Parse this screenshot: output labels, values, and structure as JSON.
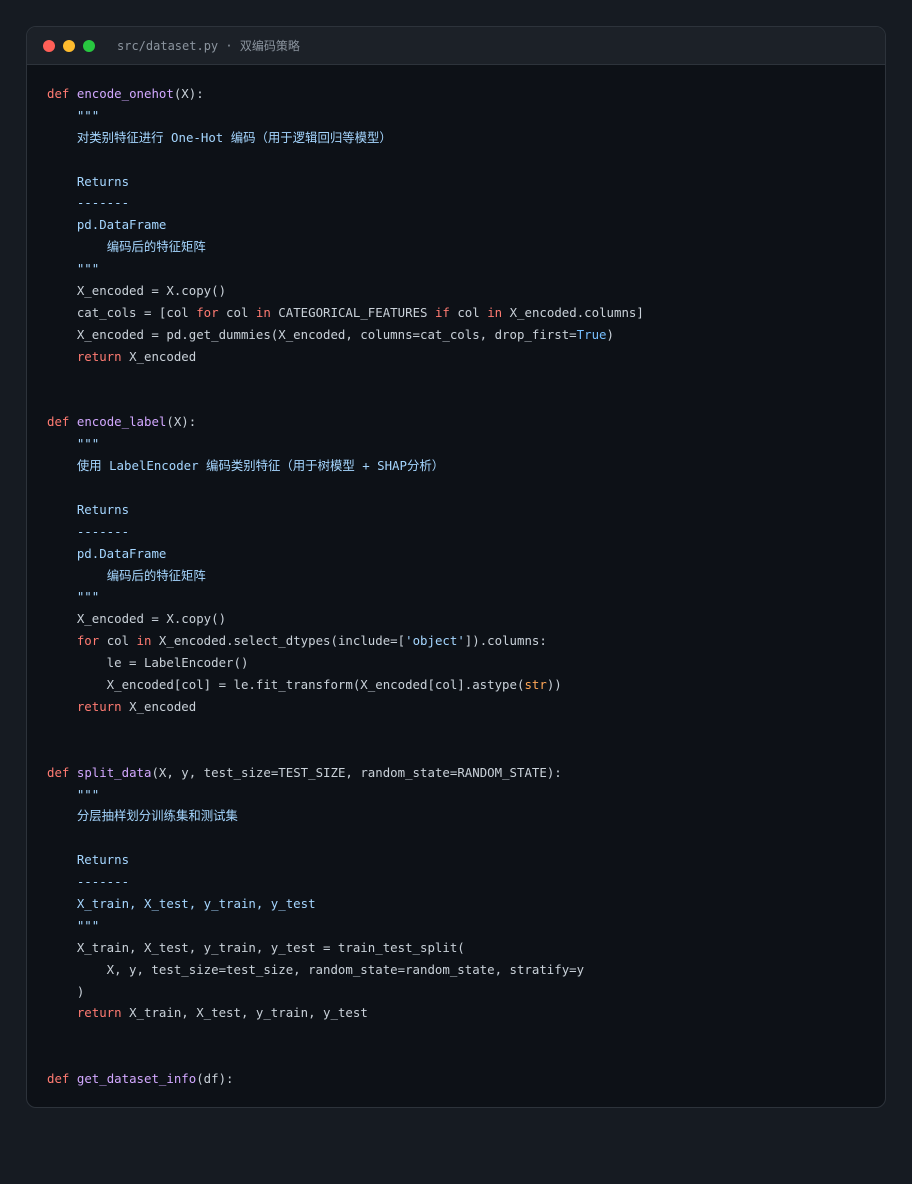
{
  "window": {
    "title": "src/dataset.py · 双编码策略",
    "colors": {
      "close": "#ff5f57",
      "minimize": "#febc2e",
      "maximize": "#28c840"
    }
  },
  "code_lines": [
    [
      {
        "t": "def",
        "c": "kw"
      },
      {
        "t": " "
      },
      {
        "t": "encode_onehot",
        "c": "fn"
      },
      {
        "t": "(X):"
      }
    ],
    [
      {
        "t": "    "
      },
      {
        "t": "\"\"\"",
        "c": "doc"
      }
    ],
    [
      {
        "t": "    "
      },
      {
        "t": "对类别特征进行 One-Hot 编码（用于逻辑回归等模型）",
        "c": "doc"
      }
    ],
    [],
    [
      {
        "t": "    "
      },
      {
        "t": "Returns",
        "c": "doc"
      }
    ],
    [
      {
        "t": "    "
      },
      {
        "t": "-------",
        "c": "doc"
      }
    ],
    [
      {
        "t": "    "
      },
      {
        "t": "pd.DataFrame",
        "c": "doc"
      }
    ],
    [
      {
        "t": "        "
      },
      {
        "t": "编码后的特征矩阵",
        "c": "doc"
      }
    ],
    [
      {
        "t": "    "
      },
      {
        "t": "\"\"\"",
        "c": "doc"
      }
    ],
    [
      {
        "t": "    X_encoded = X.copy()"
      }
    ],
    [
      {
        "t": "    cat_cols = [col "
      },
      {
        "t": "for",
        "c": "kw"
      },
      {
        "t": " col "
      },
      {
        "t": "in",
        "c": "kw"
      },
      {
        "t": " CATEGORICAL_FEATURES "
      },
      {
        "t": "if",
        "c": "kw"
      },
      {
        "t": " col "
      },
      {
        "t": "in",
        "c": "kw"
      },
      {
        "t": " X_encoded.columns]"
      }
    ],
    [
      {
        "t": "    X_encoded = pd.get_dummies(X_encoded, columns=cat_cols, drop_first="
      },
      {
        "t": "True",
        "c": "const"
      },
      {
        "t": ")"
      }
    ],
    [
      {
        "t": "    "
      },
      {
        "t": "return",
        "c": "kw"
      },
      {
        "t": " X_encoded"
      }
    ],
    [],
    [],
    [
      {
        "t": "def",
        "c": "kw"
      },
      {
        "t": " "
      },
      {
        "t": "encode_label",
        "c": "fn"
      },
      {
        "t": "(X):"
      }
    ],
    [
      {
        "t": "    "
      },
      {
        "t": "\"\"\"",
        "c": "doc"
      }
    ],
    [
      {
        "t": "    "
      },
      {
        "t": "使用 LabelEncoder 编码类别特征（用于树模型 + SHAP分析）",
        "c": "doc"
      }
    ],
    [],
    [
      {
        "t": "    "
      },
      {
        "t": "Returns",
        "c": "doc"
      }
    ],
    [
      {
        "t": "    "
      },
      {
        "t": "-------",
        "c": "doc"
      }
    ],
    [
      {
        "t": "    "
      },
      {
        "t": "pd.DataFrame",
        "c": "doc"
      }
    ],
    [
      {
        "t": "        "
      },
      {
        "t": "编码后的特征矩阵",
        "c": "doc"
      }
    ],
    [
      {
        "t": "    "
      },
      {
        "t": "\"\"\"",
        "c": "doc"
      }
    ],
    [
      {
        "t": "    X_encoded = X.copy()"
      }
    ],
    [
      {
        "t": "    "
      },
      {
        "t": "for",
        "c": "kw"
      },
      {
        "t": " col "
      },
      {
        "t": "in",
        "c": "kw"
      },
      {
        "t": " X_encoded.select_dtypes(include=["
      },
      {
        "t": "'object'",
        "c": "str"
      },
      {
        "t": "]).columns:"
      }
    ],
    [
      {
        "t": "        le = LabelEncoder()"
      }
    ],
    [
      {
        "t": "        X_encoded[col] = le.fit_transform(X_encoded[col].astype("
      },
      {
        "t": "str",
        "c": "bi"
      },
      {
        "t": "))"
      }
    ],
    [
      {
        "t": "    "
      },
      {
        "t": "return",
        "c": "kw"
      },
      {
        "t": " X_encoded"
      }
    ],
    [],
    [],
    [
      {
        "t": "def",
        "c": "kw"
      },
      {
        "t": " "
      },
      {
        "t": "split_data",
        "c": "fn"
      },
      {
        "t": "(X, y, test_size=TEST_SIZE, random_state=RANDOM_STATE):"
      }
    ],
    [
      {
        "t": "    "
      },
      {
        "t": "\"\"\"",
        "c": "doc"
      }
    ],
    [
      {
        "t": "    "
      },
      {
        "t": "分层抽样划分训练集和测试集",
        "c": "doc"
      }
    ],
    [],
    [
      {
        "t": "    "
      },
      {
        "t": "Returns",
        "c": "doc"
      }
    ],
    [
      {
        "t": "    "
      },
      {
        "t": "-------",
        "c": "doc"
      }
    ],
    [
      {
        "t": "    "
      },
      {
        "t": "X_train, X_test, y_train, y_test",
        "c": "doc"
      }
    ],
    [
      {
        "t": "    "
      },
      {
        "t": "\"\"\"",
        "c": "doc"
      }
    ],
    [
      {
        "t": "    X_train, X_test, y_train, y_test = train_test_split("
      }
    ],
    [
      {
        "t": "        X, y, test_size=test_size, random_state=random_state, stratify=y"
      }
    ],
    [
      {
        "t": "    )"
      }
    ],
    [
      {
        "t": "    "
      },
      {
        "t": "return",
        "c": "kw"
      },
      {
        "t": " X_train, X_test, y_train, y_test"
      }
    ],
    [],
    [],
    [
      {
        "t": "def",
        "c": "kw"
      },
      {
        "t": " "
      },
      {
        "t": "get_dataset_info",
        "c": "fn"
      },
      {
        "t": "(df):"
      }
    ]
  ]
}
